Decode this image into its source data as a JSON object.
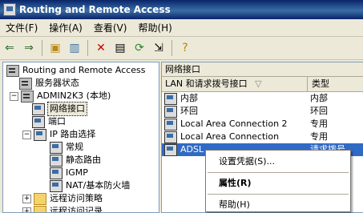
{
  "window": {
    "title": "Routing and Remote Access"
  },
  "menu": [
    "文件(F)",
    "操作(A)",
    "查看(V)",
    "帮助(H)"
  ],
  "toolbar": [
    "back-icon",
    "forward-icon",
    "up-folder-icon",
    "show-tree-icon",
    "delete-icon",
    "properties-icon",
    "refresh-icon",
    "export-icon",
    "help-icon"
  ],
  "tree": {
    "root": "Routing and Remote Access",
    "server_status": "服务器状态",
    "server": "ADMIN2K3 (本地)",
    "network_interfaces": "网络接口",
    "ports": "端口",
    "ip_routing": "IP 路由选择",
    "general": "常规",
    "static_routes": "静态路由",
    "igmp": "IGMP",
    "nat": "NAT/基本防火墙",
    "remote_access_policies": "远程访问策略",
    "remote_access_logging": "远程访问记录"
  },
  "list": {
    "pane_title": "网络接口",
    "col_name": "LAN 和请求拨号接口",
    "sort_indicator": "▽",
    "col_type": "类型",
    "rows": [
      {
        "name": "内部",
        "type": "内部"
      },
      {
        "name": "环回",
        "type": "环回"
      },
      {
        "name": "Local Area Connection 2",
        "type": "专用"
      },
      {
        "name": "Local Area Connection",
        "type": "专用"
      },
      {
        "name": "ADSL",
        "type": "请求拨号"
      }
    ]
  },
  "context_menu": {
    "set_credentials": "设置凭据(S)...",
    "properties": "属性(R)",
    "help": "帮助(H)"
  }
}
